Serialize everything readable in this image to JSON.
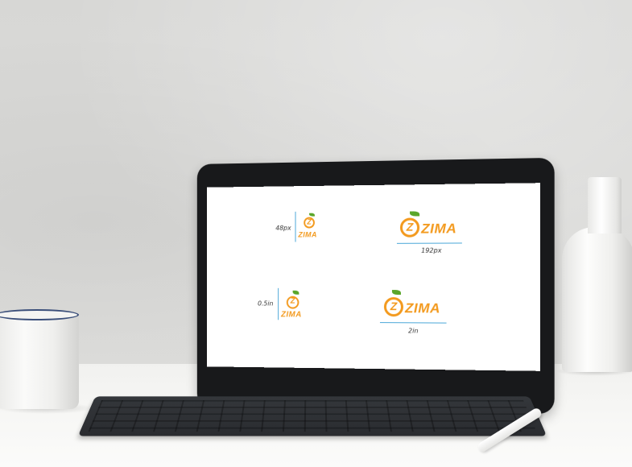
{
  "scene": {
    "screen_content": {
      "top_left": {
        "size_label": "48px",
        "wordmark": "ZIMA"
      },
      "top_right": {
        "size_label": "192px",
        "wordmark": "ZIMA"
      },
      "bottom_left": {
        "size_label": "0.5in",
        "wordmark": "ZIMA"
      },
      "bottom_right": {
        "size_label": "2in",
        "wordmark": "ZIMA"
      }
    },
    "icons": {
      "logo": "orange-z-logo-icon"
    },
    "colors": {
      "brand_orange": "#f39a1e",
      "leaf_green": "#5aa62a",
      "measure_blue": "#4aa7d8"
    }
  }
}
